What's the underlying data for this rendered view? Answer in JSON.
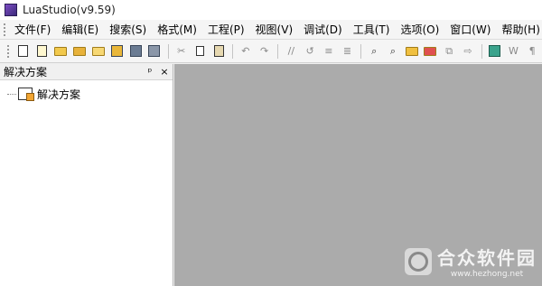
{
  "window": {
    "title": "LuaStudio(v9.59)"
  },
  "menu": [
    "文件(F)",
    "编辑(E)",
    "搜索(S)",
    "格式(M)",
    "工程(P)",
    "视图(V)",
    "调试(D)",
    "工具(T)",
    "选项(O)",
    "窗口(W)",
    "帮助(H)"
  ],
  "toolbar": {
    "icons": [
      "new-file-icon",
      "new-project-icon",
      "open-folder-icon",
      "open-project-icon",
      "recent-files-icon",
      "save-all-icon",
      "save-icon",
      "save-copy-icon",
      "cut-icon",
      "copy-icon",
      "paste-icon",
      "undo-icon",
      "redo-icon",
      "comment-icon",
      "uncomment-icon",
      "indent-icon",
      "outdent-icon",
      "find-icon",
      "find-next-icon",
      "find-in-files-icon",
      "replace-icon",
      "bookmark-icon",
      "goto-icon",
      "console-icon",
      "word-wrap-icon",
      "show-whitespace-icon"
    ]
  },
  "panel": {
    "title": "解决方案",
    "pin_label": "ᵖ",
    "close_label": "×",
    "tree": [
      {
        "label": "解决方案"
      }
    ]
  },
  "watermark": {
    "name": "合众软件园",
    "url": "www.hezhong.net"
  }
}
